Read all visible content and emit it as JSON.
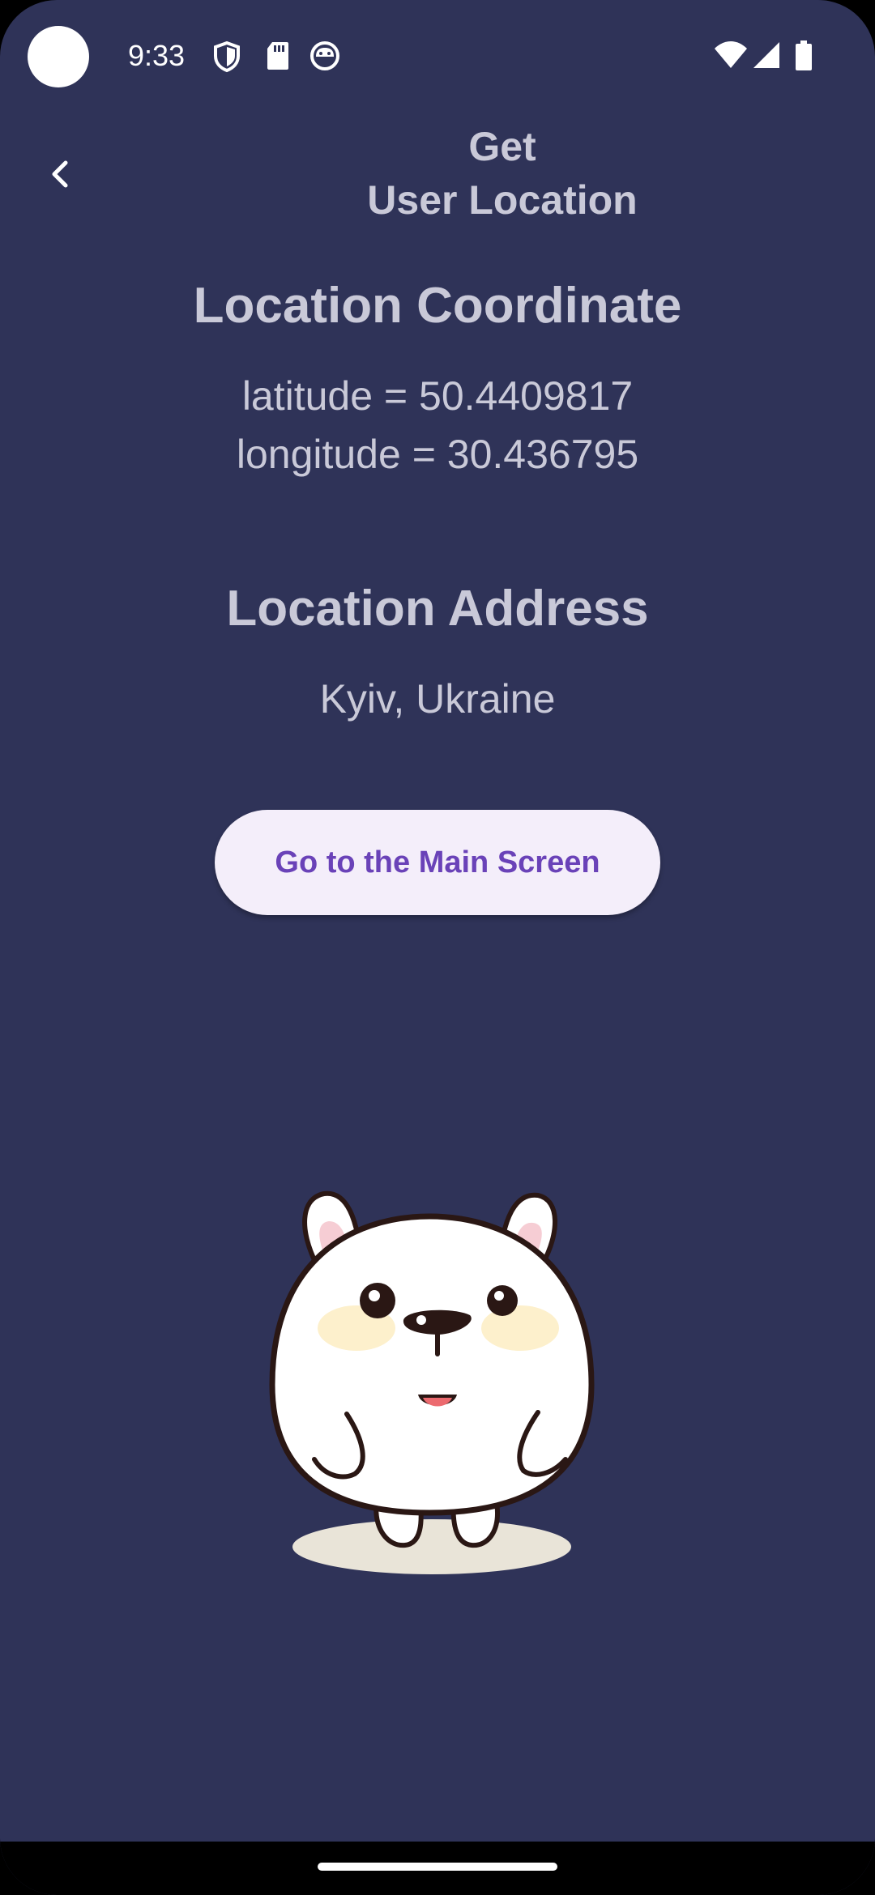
{
  "status_bar": {
    "time": "9:33",
    "left_icons": [
      "shield-icon",
      "sd-card-icon",
      "cat-face-icon"
    ],
    "right_icons": [
      "wifi-icon",
      "cell-signal-icon",
      "battery-icon"
    ]
  },
  "app_bar": {
    "back_icon": "chevron-left-icon",
    "title_line1": "Get",
    "title_line2": "User Location"
  },
  "coordinates": {
    "heading": "Location Coordinate",
    "latitude_text": "latitude = 50.4409817",
    "longitude_text": "longitude = 30.436795"
  },
  "address": {
    "heading": "Location Address",
    "value": "Kyiv, Ukraine"
  },
  "actions": {
    "main_screen_label": "Go to the Main Screen"
  },
  "illustration": {
    "name": "white-bunny-mascot"
  },
  "colors": {
    "background": "#2f3358",
    "text": "#c9c9d8",
    "button_bg": "#f4eefa",
    "button_text": "#6a42b8"
  }
}
